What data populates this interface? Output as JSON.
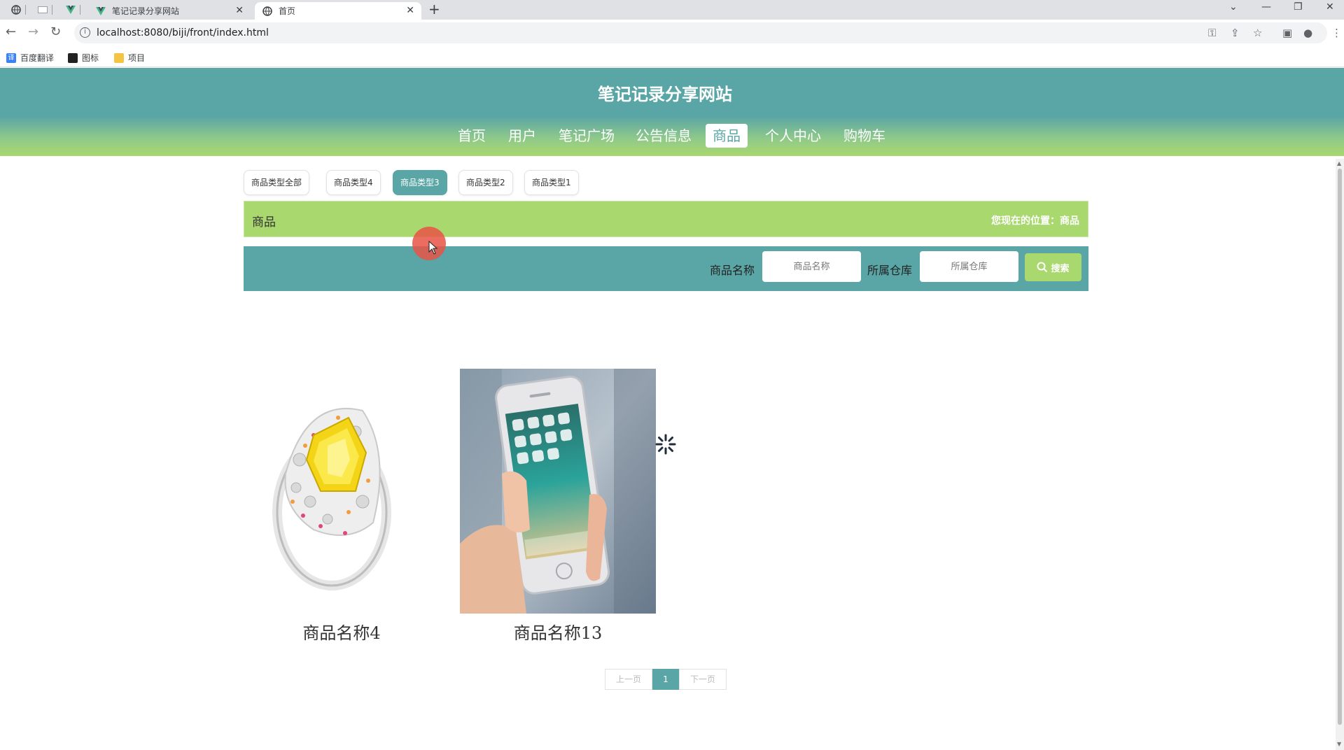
{
  "browser": {
    "tabs": [
      {
        "title": "笔记记录分享网站",
        "icon": "vue-icon",
        "active": false
      },
      {
        "title": "首页",
        "icon": "globe-icon",
        "active": true
      }
    ],
    "url": "localhost:8080/biji/front/index.html",
    "bookmarks": [
      {
        "label": "百度翻译",
        "icon": "translate-icon",
        "color": "#3b82f6"
      },
      {
        "label": "图标",
        "icon": "bookmark-icon",
        "color": "#222222"
      },
      {
        "label": "项目",
        "icon": "folder-icon",
        "color": "#f4c542"
      }
    ]
  },
  "site": {
    "title": "笔记记录分享网站",
    "nav": [
      "首页",
      "用户",
      "笔记广场",
      "公告信息",
      "商品",
      "个人中心",
      "购物车"
    ],
    "active_nav": "商品"
  },
  "categories": {
    "items": [
      "商品类型全部",
      "商品类型4",
      "商品类型3",
      "商品类型2",
      "商品类型1"
    ],
    "active": "商品类型3"
  },
  "breadcrumb": {
    "title": "商品",
    "location": "您现在的位置：商品"
  },
  "search": {
    "name_label": "商品名称",
    "name_placeholder": "商品名称",
    "warehouse_label": "所属仓库",
    "warehouse_placeholder": "所属仓库",
    "button_label": "搜索"
  },
  "products": [
    {
      "name": "商品名称4",
      "image": "diamond-ring-image"
    },
    {
      "name": "商品名称13",
      "image": "smartphone-in-hand-image"
    }
  ],
  "pagination": {
    "prev": "上一页",
    "current": "1",
    "next": "下一页"
  },
  "colors": {
    "primary": "#5aa5a5",
    "accent": "#a9d86e"
  }
}
